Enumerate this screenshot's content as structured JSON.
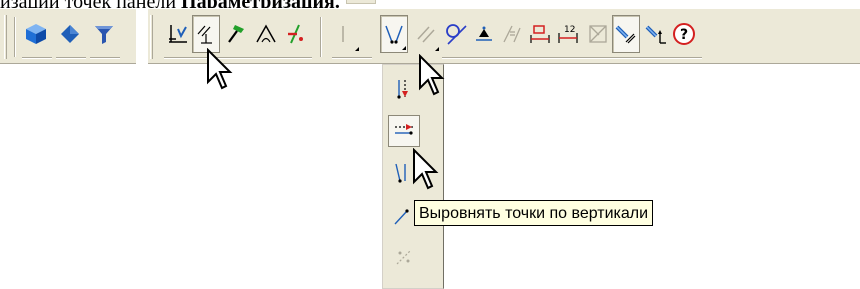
{
  "caption": {
    "text": "изации точек панели ",
    "bold": "Параметризация."
  },
  "left_toolbar": {
    "buttons": [
      {
        "icon": "cube-icon",
        "color": "#1f6fd6"
      },
      {
        "icon": "diamond-shape-icon",
        "color": "#1f5fb8"
      },
      {
        "icon": "filter-funnel-icon",
        "color": "#2a56b0"
      }
    ]
  },
  "main_toolbar": {
    "buttons": [
      {
        "icon": "fix-point-icon"
      },
      {
        "icon": "parallel-constraint-icon",
        "pressed": true
      },
      {
        "icon": "hammer-icon",
        "color": "#22a02a"
      },
      {
        "icon": "angle-constraint-icon"
      },
      {
        "icon": "delete-constraint-icon",
        "color": "#d42020"
      },
      {
        "icon": "collinear-icon",
        "disabled": true
      },
      {
        "icon": "align-points-icon",
        "pressed": true
      },
      {
        "icon": "parallel-lines-icon",
        "disabled": true
      },
      {
        "icon": "tangent-icon",
        "color": "#2a3ec8"
      },
      {
        "icon": "perpendicular-anchor-icon"
      },
      {
        "icon": "equal-length-icon",
        "disabled": true
      },
      {
        "icon": "horizontal-dimension-icon",
        "color": "#d42020"
      },
      {
        "icon": "fixed-dimension-icon",
        "color": "#d42020",
        "label": "12"
      },
      {
        "icon": "drawing-frame-icon",
        "disabled": true
      },
      {
        "icon": "show-constraints-icon",
        "pressed": true
      },
      {
        "icon": "show-degrees-icon"
      },
      {
        "icon": "help-icon",
        "color": "#d42020"
      }
    ]
  },
  "flyout": {
    "buttons": [
      {
        "icon": "align-vertical-points-icon"
      },
      {
        "icon": "align-horizontal-points-icon",
        "pressed": true
      },
      {
        "icon": "align-points-vertically-icon"
      },
      {
        "icon": "align-point-to-line-icon"
      },
      {
        "icon": "symmetric-points-icon",
        "disabled": true
      }
    ]
  },
  "tooltip": {
    "text": "Выровнять точки по вертикали"
  },
  "colors": {
    "toolbar_bg": "#ece9d8",
    "tooltip_bg": "#ffffe1",
    "icon_blue": "#1f5fb8",
    "icon_red": "#d42020",
    "icon_green": "#22a02a"
  }
}
